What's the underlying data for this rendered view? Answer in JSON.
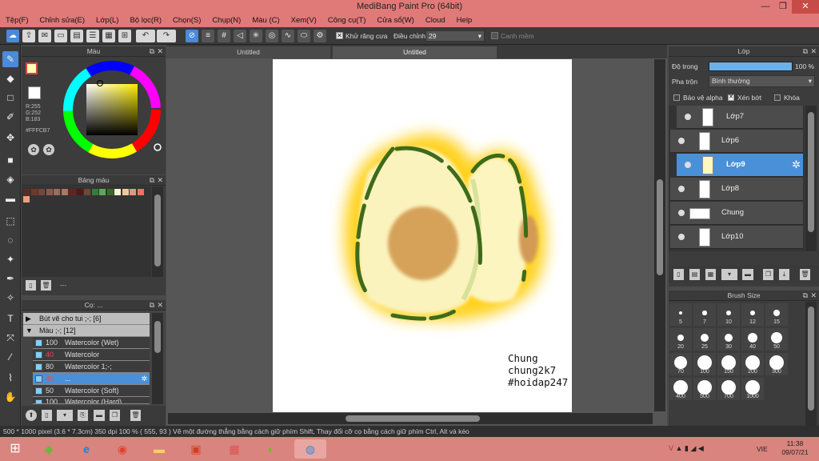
{
  "window": {
    "title": "MediBang Paint Pro (64bit)",
    "minimize": "—",
    "restore": "❐",
    "close": "✕"
  },
  "menu": [
    "Tệp(F)",
    "Chỉnh sửa(E)",
    "Lớp(L)",
    "Bộ lọc(R)",
    "Chọn(S)",
    "Chụp(N)",
    "Màu (C)",
    "Xem(V)",
    "Công cụ(T)",
    "Cửa sổ(W)",
    "Cloud",
    "Help"
  ],
  "toolbar": {
    "antialias_label": "Khử răng cưa",
    "correction_label": "Điều chỉnh",
    "correction_value": "29",
    "snap_label": "Canh mềm"
  },
  "color_panel": {
    "title": "Màu",
    "r": "R:255",
    "g": "G:252",
    "b": "B:183",
    "hex": "#FFFCB7"
  },
  "palette_panel": {
    "title": "Bảng màu",
    "footer_dash": "---",
    "colors": [
      "#5a2c22",
      "#6e3a2c",
      "#7a4438",
      "#8b5a4e",
      "#9a6a5c",
      "#a87868",
      "#6b2020",
      "#4e1a18",
      "#6a4a3a",
      "#3a7a3a",
      "#5aa85a",
      "#3a6a2a",
      "#fff4d0",
      "#f0c89a",
      "#e0987a",
      "#f07060",
      "#e8a080"
    ]
  },
  "brush_panel": {
    "title": "Cọ: ...",
    "groups": [
      {
        "label": "Bút vẽ cho tui ;-; [6]"
      },
      {
        "label": "Màu ;-; [12]"
      }
    ],
    "items": [
      {
        "size": "100",
        "name": "Watercolor (Wet)"
      },
      {
        "size": "40",
        "name": "Watercolor"
      },
      {
        "size": "80",
        "name": "Watercolor 1;-;"
      },
      {
        "size": "40",
        "name": "..."
      },
      {
        "size": "50",
        "name": "Watercolor (Soft)"
      },
      {
        "size": "100",
        "name": "Watercolor (Hard)"
      }
    ]
  },
  "tabs": [
    "Untitled",
    "Untitled"
  ],
  "canvas": {
    "watermark": [
      "Chung",
      "chung2k7",
      "#hoidap247"
    ]
  },
  "layer_panel": {
    "title": "Lớp",
    "opacity_label": "Độ trong",
    "opacity_value": "100 %",
    "opacity_fraction": 1.0,
    "blend_label": "Pha trộn",
    "blend_value": "Bình thường",
    "protect_alpha": "Bảo vệ alpha",
    "clipping": "Xén bớt",
    "lock": "Khóa",
    "layers": [
      {
        "name": "Lớp7",
        "selected": false
      },
      {
        "name": "Lớp6",
        "selected": false
      },
      {
        "name": "Lớp9",
        "selected": true
      },
      {
        "name": "Lớp8",
        "selected": false
      },
      {
        "name": "Chung",
        "selected": false
      },
      {
        "name": "Lớp10",
        "selected": false
      }
    ]
  },
  "brush_size_panel": {
    "title": "Brush Size",
    "sizes": [
      "5",
      "7",
      "10",
      "12",
      "15",
      "20",
      "25",
      "30",
      "40",
      "50",
      "70",
      "100",
      "150",
      "200",
      "300",
      "400",
      "500",
      "700",
      "1000"
    ]
  },
  "status": {
    "text": "500 * 1000 pixel   (3.6 * 7.3cm)   350 dpi   100 %   ( 555, 93 )   Vẽ một đường thẳng bằng cách giữ phím Shift, Thay đổi cỡ cọ bằng cách giữ phím Ctrl, Alt và kéo"
  },
  "taskbar": {
    "lang": "VIE",
    "time": "11:38",
    "date": "09/07/21"
  }
}
